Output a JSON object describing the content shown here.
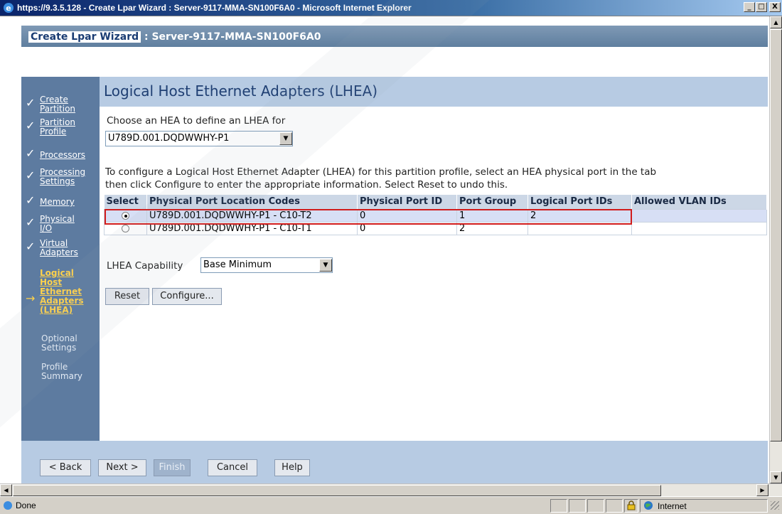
{
  "window": {
    "title": "https://9.3.5.128 - Create Lpar Wizard : Server-9117-MMA-SN100F6A0 - Microsoft Internet Explorer",
    "minimize": "_",
    "maximize": "□",
    "close": "X"
  },
  "wizard": {
    "title_prefix": "Create Lpar Wizard",
    "title_suffix": " : Server-9117-MMA-SN100F6A0"
  },
  "sidebar": {
    "items": [
      {
        "label": "Create Partition",
        "state": "done"
      },
      {
        "label": "Partition Profile",
        "state": "done"
      },
      {
        "label": "Processors",
        "state": "done"
      },
      {
        "label": "Processing Settings",
        "state": "done"
      },
      {
        "label": "Memory",
        "state": "done"
      },
      {
        "label": "Physical I/O",
        "state": "done"
      },
      {
        "label": "Virtual Adapters",
        "state": "done"
      },
      {
        "label": "Logical Host Ethernet Adapters (LHEA)",
        "state": "current"
      },
      {
        "label": "Optional Settings",
        "state": "pending"
      },
      {
        "label": "Profile Summary",
        "state": "pending"
      }
    ],
    "check_glyph": "✓",
    "arrow_glyph": "→"
  },
  "content": {
    "heading": "Logical Host Ethernet Adapters (LHEA)",
    "choose_label": "Choose an HEA to define an LHEA for",
    "hea_select_value": "U789D.001.DQDWWHY-P1",
    "instructions_line1": "To configure a Logical Host Ethernet Adapter (LHEA) for this partition profile, select an HEA physical port in the tab",
    "instructions_line2": "then click Configure to enter the appropriate information. Select Reset to undo this.",
    "table": {
      "headers": [
        "Select",
        "Physical Port Location Codes",
        "Physical Port ID",
        "Port Group",
        "Logical Port IDs",
        "Allowed VLAN IDs"
      ],
      "rows": [
        {
          "selected": true,
          "location": "U789D.001.DQDWWHY-P1 - C10-T2",
          "port_id": "0",
          "port_group": "1",
          "logical_ids": "2",
          "vlan_ids": ""
        },
        {
          "selected": false,
          "location": "U789D.001.DQDWWHY-P1 - C10-T1",
          "port_id": "0",
          "port_group": "2",
          "logical_ids": "",
          "vlan_ids": ""
        }
      ]
    },
    "capability_label": "LHEA Capability",
    "capability_value": "Base Minimum",
    "reset_button": "Reset",
    "configure_button": "Configure..."
  },
  "footer": {
    "back_button": "< Back",
    "next_button": "Next >",
    "finish_button": "Finish",
    "cancel_button": "Cancel",
    "help_button": "Help"
  },
  "status": {
    "text": "Done",
    "zone": "Internet"
  },
  "colors": {
    "sidebar_bg": "#5d7ba0",
    "content_bar_bg": "#b7cbe3",
    "highlight_border": "#d11c1c",
    "current_step": "#ffd24a"
  }
}
